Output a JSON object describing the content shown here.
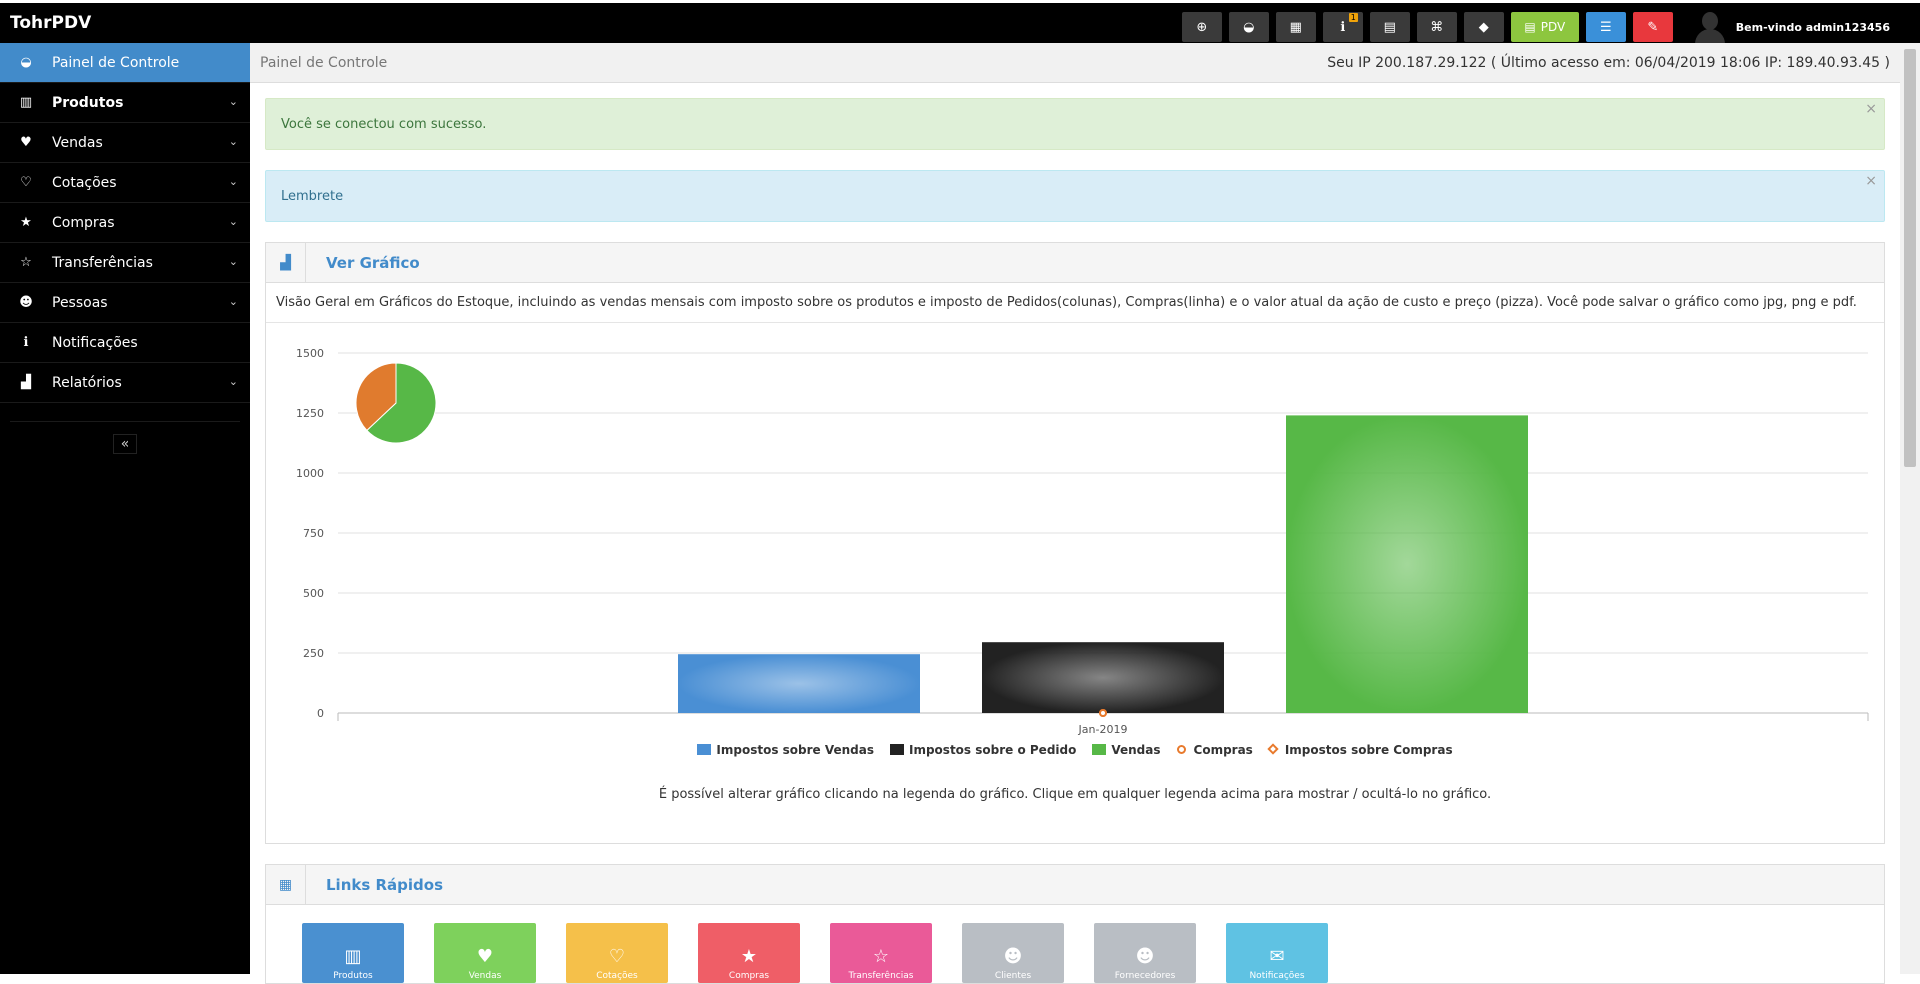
{
  "app": {
    "title": "TohrPDV"
  },
  "topbar": {
    "buttons": [
      {
        "name": "plus-circle-icon",
        "glyph": "⊕"
      },
      {
        "name": "dashboard-icon",
        "glyph": "◒"
      },
      {
        "name": "calculator-icon",
        "glyph": "▦"
      },
      {
        "name": "info-icon",
        "glyph": "ℹ",
        "badge": "1"
      },
      {
        "name": "calendar-icon",
        "glyph": "▤"
      },
      {
        "name": "html-icon",
        "glyph": "⌘"
      },
      {
        "name": "brazil-flag-icon",
        "glyph": "◆"
      }
    ],
    "pdv_label": "PDV",
    "welcome": "Bem-vindo admin123456"
  },
  "sidebar": {
    "items": [
      {
        "label": "Painel de Controle",
        "icon": "dashboard-icon",
        "glyph": "◒",
        "chevron": false,
        "active": true
      },
      {
        "label": "Produtos",
        "icon": "barcode-icon",
        "glyph": "▥",
        "chevron": true,
        "bold": true
      },
      {
        "label": "Vendas",
        "icon": "heart-icon",
        "glyph": "♥",
        "chevron": true
      },
      {
        "label": "Cotações",
        "icon": "heart-outline-icon",
        "glyph": "♡",
        "chevron": true
      },
      {
        "label": "Compras",
        "icon": "star-icon",
        "glyph": "★",
        "chevron": true
      },
      {
        "label": "Transferências",
        "icon": "star-outline-icon",
        "glyph": "☆",
        "chevron": true
      },
      {
        "label": "Pessoas",
        "icon": "users-icon",
        "glyph": "☻",
        "chevron": true
      },
      {
        "label": "Notificações",
        "icon": "info-icon",
        "glyph": "ℹ",
        "chevron": false
      },
      {
        "label": "Relatórios",
        "icon": "bar-chart-icon",
        "glyph": "▟",
        "chevron": true
      }
    ],
    "collapse_glyph": "«"
  },
  "header": {
    "breadcrumb": "Painel de Controle",
    "ip_info": "Seu IP 200.187.29.122 ( Último acesso em: 06/04/2019 18:06 IP: 189.40.93.45 )"
  },
  "alerts": {
    "success": "Você se conectou com sucesso.",
    "info": "Lembrete",
    "close": "×"
  },
  "chart_box": {
    "title": "Ver Gráfico",
    "description": "Visão Geral em Gráficos do Estoque, incluindo as vendas mensais com imposto sobre os produtos e imposto de Pedidos(colunas), Compras(linha) e o valor atual da ação de custo e preço (pizza). Você pode salvar o gráfico como jpg, png e pdf.",
    "note": "É possível alterar gráfico clicando na legenda do gráfico. Clique em qualquer legenda acima para mostrar / ocultá-lo no gráfico."
  },
  "chart_data": {
    "type": "bar",
    "categories": [
      "Jan-2019"
    ],
    "ylim": [
      0,
      1500
    ],
    "yticks": [
      0,
      250,
      500,
      750,
      1000,
      1250,
      1500
    ],
    "series": [
      {
        "name": "Impostos sobre Vendas",
        "type": "bar",
        "values": [
          245
        ],
        "color": "#4a8fd4"
      },
      {
        "name": "Impostos sobre o Pedido",
        "type": "bar",
        "values": [
          295
        ],
        "color": "#222222"
      },
      {
        "name": "Vendas",
        "type": "bar",
        "values": [
          1240
        ],
        "color": "#57b847"
      },
      {
        "name": "Compras",
        "type": "line",
        "values": [
          0
        ],
        "color": "#e87a2d"
      },
      {
        "name": "Impostos sobre Compras",
        "type": "line",
        "values": [
          0
        ],
        "color": "#e87a2d"
      }
    ],
    "pie": {
      "slices": [
        {
          "value": 63,
          "color": "#57b847"
        },
        {
          "value": 37,
          "color": "#e07b2e"
        }
      ]
    },
    "legend_position": "bottom",
    "grid": true
  },
  "quick_links": {
    "title": "Links Rápidos",
    "items": [
      {
        "label": "Produtos",
        "color": "#4a90d0",
        "icon": "barcode-icon",
        "glyph": "▥"
      },
      {
        "label": "Vendas",
        "color": "#7ed15c",
        "icon": "heart-icon",
        "glyph": "♥"
      },
      {
        "label": "Cotações",
        "color": "#f5c04a",
        "icon": "heart-outline-icon",
        "glyph": "♡"
      },
      {
        "label": "Compras",
        "color": "#ef5e67",
        "icon": "star-icon",
        "glyph": "★"
      },
      {
        "label": "Transferências",
        "color": "#ea5a98",
        "icon": "star-outline-icon",
        "glyph": "☆"
      },
      {
        "label": "Clientes",
        "color": "#b9bec4",
        "icon": "users-icon",
        "glyph": "☻"
      },
      {
        "label": "Fornecedores",
        "color": "#b9bec4",
        "icon": "users-icon",
        "glyph": "☻"
      },
      {
        "label": "Notificações",
        "color": "#5fc2e3",
        "icon": "comments-icon",
        "glyph": "✉"
      }
    ]
  }
}
